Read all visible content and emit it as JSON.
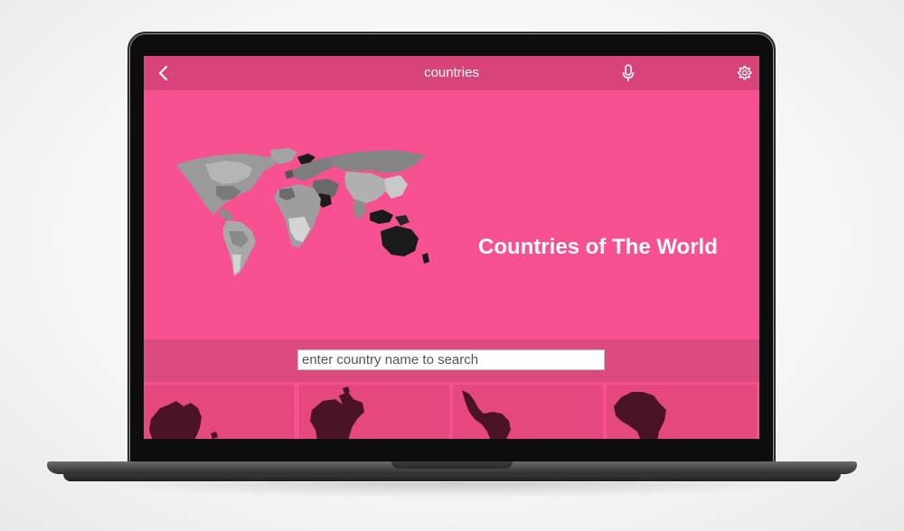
{
  "topbar": {
    "title": "countries",
    "back_icon": "chevron-left-icon",
    "mic_icon": "microphone-icon",
    "settings_icon": "gear-icon"
  },
  "hero": {
    "title": "Countries of The World",
    "image": "world-map"
  },
  "search": {
    "placeholder": "enter country name to search",
    "value": ""
  },
  "continents": [
    {
      "name": "australia",
      "icon": "australia-map-icon"
    },
    {
      "name": "north-america",
      "icon": "north-america-map-icon"
    },
    {
      "name": "south-america",
      "icon": "south-america-map-icon"
    },
    {
      "name": "africa",
      "icon": "africa-map-icon"
    }
  ],
  "colors": {
    "background": "#f55192",
    "topbar": "#d8447a",
    "search_strip": "#dc4b80",
    "tile": "#e4487f",
    "continent_fill": "#4a1426",
    "text": "#ffffff"
  }
}
